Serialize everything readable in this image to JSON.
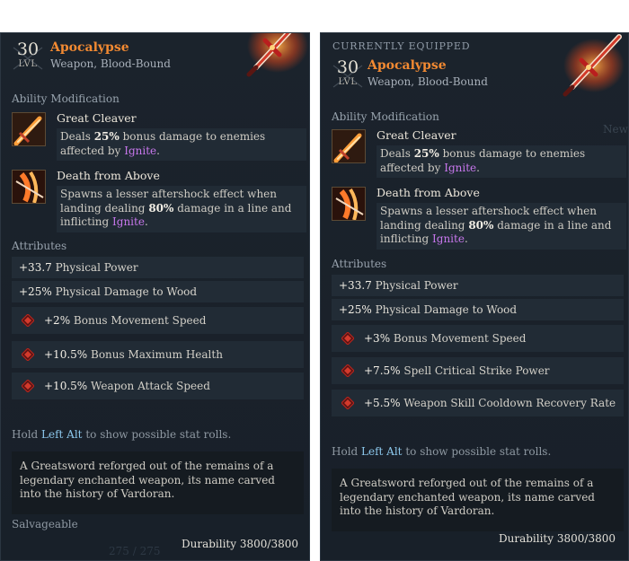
{
  "left": {
    "level": "30",
    "level_label": "LVL",
    "name": "Apocalypse",
    "type": "Weapon, Blood-Bound",
    "ability_section": "Ability Modification",
    "abilities": [
      {
        "name": "Great Cleaver",
        "desc_pre": "Deals ",
        "desc_bold": "25%",
        "desc_mid": " bonus damage to enemies affected by ",
        "desc_keyword": "Ignite",
        "desc_post": "."
      },
      {
        "name": "Death from Above",
        "desc_pre": "Spawns a lesser aftershock effect when landing dealing ",
        "desc_bold": "80%",
        "desc_mid": " damage in a line and inflicting ",
        "desc_keyword": "Ignite",
        "desc_post": "."
      }
    ],
    "attributes_section": "Attributes",
    "attributes": [
      {
        "value": "+33.7",
        "label": "Physical Power"
      },
      {
        "value": "+25%",
        "label": "Physical Damage to Wood"
      }
    ],
    "gem_attributes": [
      {
        "value": "+2%",
        "label": "Bonus Movement Speed"
      },
      {
        "value": "+10.5%",
        "label": "Bonus Maximum Health"
      },
      {
        "value": "+10.5%",
        "label": "Weapon Attack Speed"
      }
    ],
    "hint_pre": "Hold ",
    "hint_key": "Left Alt",
    "hint_post": " to show possible stat rolls.",
    "lore": "A Greatsword reforged out of the remains of a legendary enchanted weapon, its name carved into the history of Vardoran.",
    "salvage": "Salvageable",
    "durability_label": "Durability",
    "durability_value": "3800/3800",
    "ghost_text": "275 / 275"
  },
  "right": {
    "equipped_tag": "CURRENTLY EQUIPPED",
    "level": "30",
    "level_label": "LVL",
    "name": "Apocalypse",
    "type": "Weapon, Blood-Bound",
    "ghost_text": "New",
    "ability_section": "Ability Modification",
    "abilities": [
      {
        "name": "Great Cleaver",
        "desc_pre": "Deals ",
        "desc_bold": "25%",
        "desc_mid": " bonus damage to enemies affected by ",
        "desc_keyword": "Ignite",
        "desc_post": "."
      },
      {
        "name": "Death from Above",
        "desc_pre": "Spawns a lesser aftershock effect when landing dealing ",
        "desc_bold": "80%",
        "desc_mid": " damage in a line and inflicting ",
        "desc_keyword": "Ignite",
        "desc_post": "."
      }
    ],
    "attributes_section": "Attributes",
    "attributes": [
      {
        "value": "+33.7",
        "label": "Physical Power"
      },
      {
        "value": "+25%",
        "label": "Physical Damage to Wood"
      }
    ],
    "gem_attributes": [
      {
        "value": "+3%",
        "label": "Bonus Movement Speed"
      },
      {
        "value": "+7.5%",
        "label": "Spell Critical Strike Power"
      },
      {
        "value": "+5.5%",
        "label": "Weapon Skill Cooldown Recovery Rate"
      }
    ],
    "hint_pre": "Hold ",
    "hint_key": "Left Alt",
    "hint_post": " to show possible stat rolls.",
    "lore": "A Greatsword reforged out of the remains of a legendary enchanted weapon, its name carved into the history of Vardoran.",
    "durability_label": "Durability",
    "durability_value": "3800/3800"
  },
  "colors": {
    "legendary_name": "#f38a32",
    "keyword_ignite": "#c777ec",
    "keybind": "#8cc7ec",
    "panel_bg": "#1b232c"
  },
  "icons": {
    "weapon": "flaming-sword-icon",
    "ability_1": "greatsword-slash-icon",
    "ability_2": "fiery-aftershock-icon",
    "gem": "blood-gem-icon"
  }
}
